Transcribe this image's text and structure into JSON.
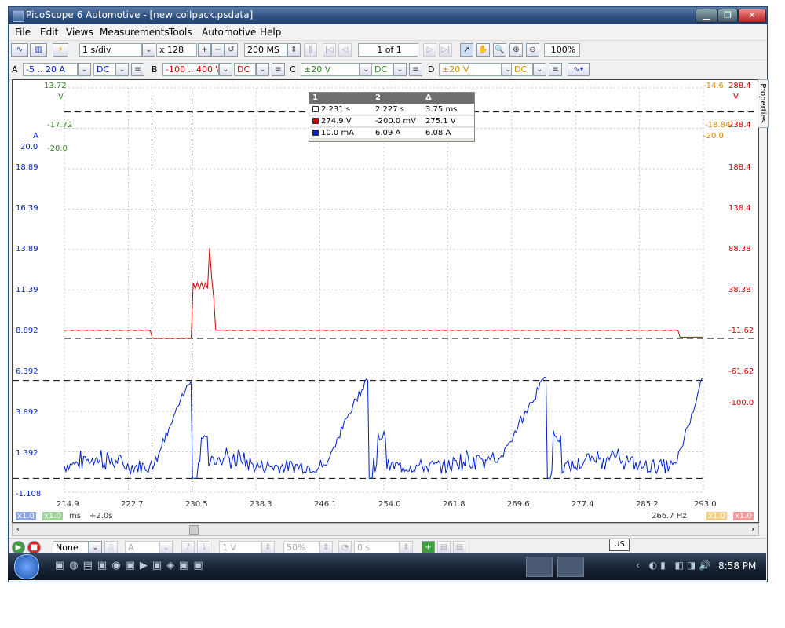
{
  "window": {
    "title": "PicoScope 6 Automotive - [new coilpack.psdata]",
    "minimize_icon": "minimize-icon",
    "maximize_icon": "restore-icon",
    "close_icon": "close-icon"
  },
  "menu": [
    "File",
    "Edit",
    "Views",
    "Measurements",
    "Tools",
    "Automotive",
    "Help"
  ],
  "toolbar1": {
    "timebase": "1 s/div",
    "zoom": "x 128",
    "samples": "200 MS",
    "page": "1 of 1",
    "zoom_percent": "100%"
  },
  "channels": {
    "a": {
      "letter": "A",
      "range": "-5 .. 20 A",
      "coupling": "DC"
    },
    "b": {
      "letter": "B",
      "range": "-100 .. 400 V",
      "coupling": "DC"
    },
    "c": {
      "letter": "C",
      "range": "±20 V",
      "coupling": "DC"
    },
    "d": {
      "letter": "D",
      "range": "±20 V",
      "coupling": "DC"
    }
  },
  "scope": {
    "green_axis": {
      "top": "13.72",
      "unit": "V",
      "mid": "-17.72",
      "bottom": "-20.0"
    },
    "blue_axis_labels": [
      "A",
      "20.0",
      "18.89",
      "16.39",
      "13.89",
      "11.39",
      "8.892",
      "6.392",
      "3.892",
      "1.392",
      "-1.108"
    ],
    "orange_axis": {
      "top": "-14.6",
      "mid": "-18.84",
      "bottom": "-20.0"
    },
    "red_axis_labels": [
      "288.4",
      "V",
      "238.4",
      "188.4",
      "138.4",
      "88.38",
      "38.38",
      "-11.62",
      "-61.62",
      "-100.0"
    ],
    "x_ticks": [
      "214.9",
      "222.7",
      "230.5",
      "238.3",
      "246.1",
      "254.0",
      "261.8",
      "269.6",
      "277.4",
      "285.2",
      "293.0"
    ],
    "x_unit": "ms",
    "x_offset": "+2.0s",
    "freq": "266.7 Hz",
    "scale_tags": [
      "x1.0",
      "x1.0",
      "x1.0",
      "x1.0"
    ],
    "props_label": "Properties"
  },
  "cursor_table": {
    "headers": [
      "1",
      "2",
      "Δ"
    ],
    "rows": [
      [
        "2.231 s",
        "2.227 s",
        "3.75 ms"
      ],
      [
        "274.9 V",
        "-200.0 mV",
        "275.1 V"
      ],
      [
        "10.0 mA",
        "6.09 A",
        "6.08 A"
      ]
    ],
    "row_colors": [
      "#ffffff",
      "#d40000",
      "#0020c8"
    ]
  },
  "statusbar": {
    "trigger_mode": "None",
    "channel": "A",
    "threshold": "1 V",
    "pre_trigger": "50%",
    "delay": "0 s"
  },
  "taskbar": {
    "lang": "US",
    "clock": "8:58 PM"
  },
  "chart_data": {
    "type": "line",
    "xlabel": "ms",
    "xlim": [
      214.9,
      293.0
    ],
    "series": [
      {
        "name": "B",
        "color": "#d40000",
        "x": [
          214.9,
          225.6,
          225.7,
          230.5,
          230.6,
          232.0,
          232.6,
          233.2,
          233.4,
          234.2,
          293.0
        ],
        "y": [
          -1.5,
          -1.5,
          -11.6,
          -1.5,
          55,
          58,
          110,
          58,
          -1.5,
          -1.5,
          -10
        ]
      },
      {
        "name": "A",
        "color": "#0020c8",
        "x": [
          214.9,
          221,
          225.6,
          230.5,
          230.6,
          252,
          252.1,
          273.8,
          273.9,
          293.0
        ],
        "y": [
          0.3,
          1.5,
          0.3,
          6.2,
          0,
          5.8,
          0,
          6.3,
          0,
          4.8
        ]
      }
    ]
  }
}
